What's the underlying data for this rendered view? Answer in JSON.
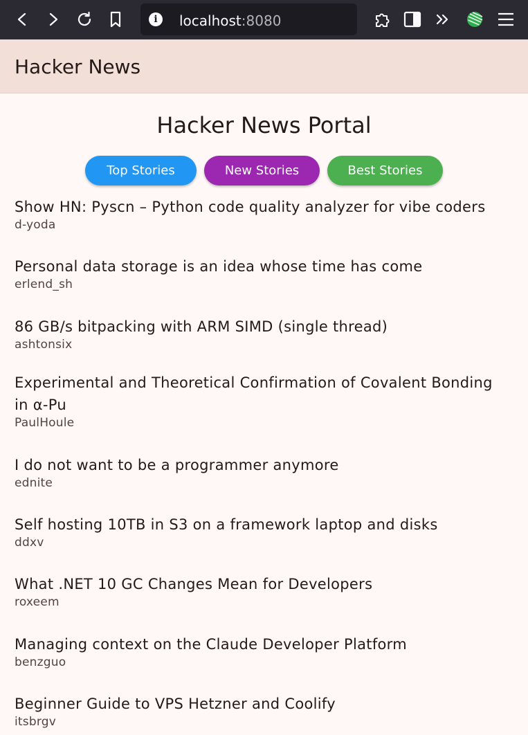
{
  "browser": {
    "url_host": "localhost",
    "url_port": ":8080"
  },
  "app_bar": {
    "title": "Hacker News"
  },
  "page": {
    "title": "Hacker News Portal"
  },
  "buttons": {
    "top": "Top Stories",
    "new": "New Stories",
    "best": "Best Stories"
  },
  "colors": {
    "top_button": "#2196f3",
    "new_button": "#9c27b0",
    "best_button": "#4caf50",
    "app_bar": "#f2dfd8"
  },
  "stories": [
    {
      "title": "Show HN: Pyscn – Python code quality analyzer for vibe coders",
      "author": "d-yoda"
    },
    {
      "title": "Personal data storage is an idea whose time has come",
      "author": "erlend_sh"
    },
    {
      "title": "86 GB/s bitpacking with ARM SIMD (single thread)",
      "author": "ashtonsix"
    },
    {
      "title": "Experimental and Theoretical Confirmation of Covalent Bonding in α-Pu",
      "author": "PaulHoule"
    },
    {
      "title": "I do not want to be a programmer anymore",
      "author": "ednite"
    },
    {
      "title": "Self hosting 10TB in S3 on a framework laptop and disks",
      "author": "ddxv"
    },
    {
      "title": "What .NET 10 GC Changes Mean for Developers",
      "author": "roxeem"
    },
    {
      "title": "Managing context on the Claude Developer Platform",
      "author": "benzguo"
    },
    {
      "title": "Beginner Guide to VPS Hetzner and Coolify",
      "author": "itsbrgv"
    }
  ]
}
